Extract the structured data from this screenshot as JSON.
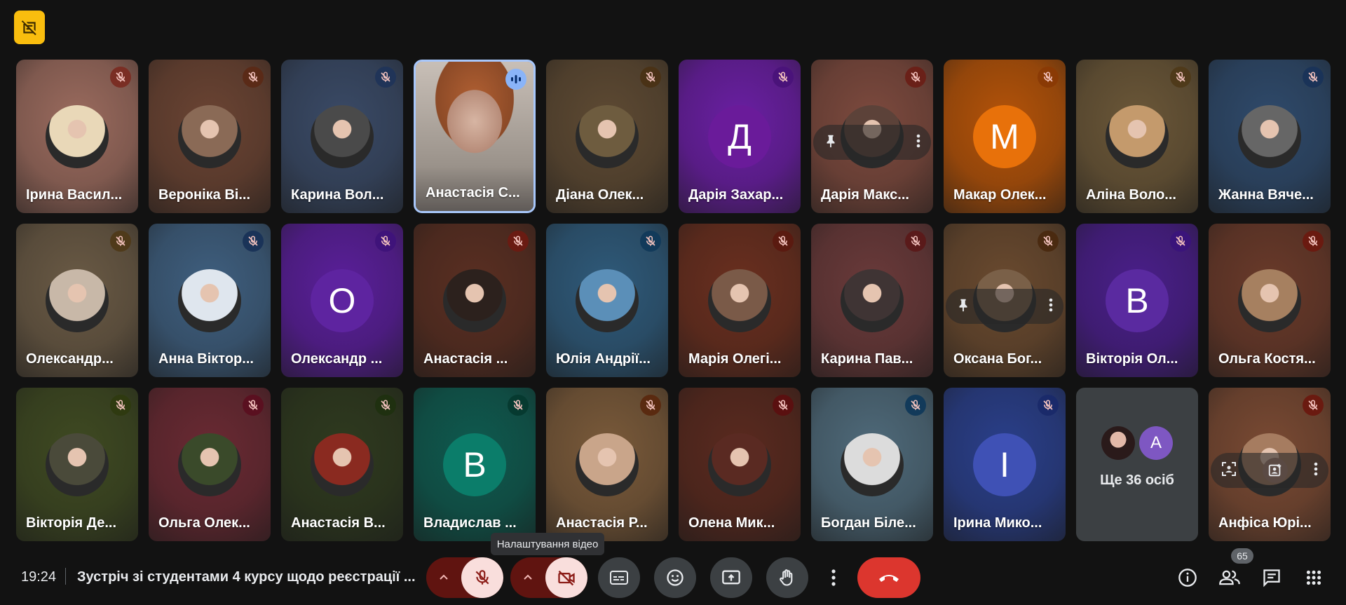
{
  "participants": [
    {
      "name": "Ірина Васил...",
      "bg": "#9b6b5e",
      "avatar": "photo",
      "avatar_color": "#e9d8b8",
      "mic_color": "#7a2e24"
    },
    {
      "name": "Вероніка Ві...",
      "bg": "#6b4433",
      "avatar": "photo",
      "avatar_color": "#8a6a56",
      "mic_color": "#5a2a17"
    },
    {
      "name": "Карина Вол...",
      "bg": "#3a4a66",
      "avatar": "photo",
      "avatar_color": "#4a4a4a",
      "mic_color": "#203458"
    },
    {
      "name": "Анастасія С...",
      "bg": "#b79a8c",
      "avatar": "video",
      "avatar_color": "#c9a090",
      "mic_color": "#8ab4f8",
      "speaking": true
    },
    {
      "name": "Діана Олек...",
      "bg": "#5e4a33",
      "avatar": "photo",
      "avatar_color": "#6e5c3f",
      "mic_color": "#4a3216"
    },
    {
      "name": "Дарія Захар...",
      "bg": "#6a1fa3",
      "avatar": "letter",
      "letter": "Д",
      "avatar_color": "#6a1b9a",
      "mic_color": "#4a137a"
    },
    {
      "name": "Дарія Макс...",
      "bg": "#7d4a3e",
      "avatar": "photo",
      "avatar_color": "#5c4239",
      "mic_color": "#6a2018",
      "hover": true
    },
    {
      "name": "Макар Олек...",
      "bg": "#b45309",
      "avatar": "letter",
      "letter": "М",
      "avatar_color": "#e8710a",
      "mic_color": "#8a3a05"
    },
    {
      "name": "Аліна Воло...",
      "bg": "#6b5738",
      "avatar": "photo",
      "avatar_color": "#c49a6c",
      "mic_color": "#4f3a1a"
    },
    {
      "name": "Жанна Вяче...",
      "bg": "#2f4a6b",
      "avatar": "photo",
      "avatar_color": "#666666",
      "mic_color": "#1a3358"
    },
    {
      "name": "Олександр...",
      "bg": "#6a5a45",
      "avatar": "photo",
      "avatar_color": "#c8b8a8",
      "mic_color": "#4f3a1a"
    },
    {
      "name": "Анна Віктор...",
      "bg": "#3f5f7f",
      "avatar": "photo",
      "avatar_color": "#dfe6ee",
      "mic_color": "#1a3358"
    },
    {
      "name": "Олександр ...",
      "bg": "#5a1f9a",
      "avatar": "letter",
      "letter": "О",
      "avatar_color": "#5e24a0",
      "mic_color": "#3f137a"
    },
    {
      "name": "Анастасія ...",
      "bg": "#5a2f22",
      "avatar": "photo",
      "avatar_color": "#2c211d",
      "mic_color": "#6a1b12"
    },
    {
      "name": "Юлія Андрії...",
      "bg": "#2f5a7a",
      "avatar": "photo",
      "avatar_color": "#5b8fb8",
      "mic_color": "#123a5a"
    },
    {
      "name": "Марія Олегі...",
      "bg": "#6a2f1f",
      "avatar": "photo",
      "avatar_color": "#7a5a48",
      "mic_color": "#5a1a10"
    },
    {
      "name": "Карина Пав...",
      "bg": "#6a3a3a",
      "avatar": "photo",
      "avatar_color": "#3f3434",
      "mic_color": "#5a1a1a"
    },
    {
      "name": "Оксана Бог...",
      "bg": "#6a4a2f",
      "avatar": "photo",
      "avatar_color": "#7a6048",
      "mic_color": "#4a2a10",
      "hover": true
    },
    {
      "name": "Вікторія Ол...",
      "bg": "#4a1f8a",
      "avatar": "letter",
      "letter": "В",
      "avatar_color": "#5a2aa0",
      "mic_color": "#3a147a"
    },
    {
      "name": "Ольга Костя...",
      "bg": "#6a3a2a",
      "avatar": "photo",
      "avatar_color": "#a68060",
      "mic_color": "#6a1a10"
    },
    {
      "name": "Вікторія Де...",
      "bg": "#3f4a22",
      "avatar": "photo",
      "avatar_color": "#4a4a3a",
      "mic_color": "#2f3a10"
    },
    {
      "name": "Ольга Олек...",
      "bg": "#6a2a33",
      "avatar": "photo",
      "avatar_color": "#3a4a2a",
      "mic_color": "#5a1020"
    },
    {
      "name": "Анастасія В...",
      "bg": "#2f3a1f",
      "avatar": "photo",
      "avatar_color": "#8a2a20",
      "mic_color": "#1f3010"
    },
    {
      "name": "Владислав ...",
      "bg": "#0f5a4f",
      "avatar": "letter",
      "letter": "В",
      "avatar_color": "#0b7d6a",
      "mic_color": "#063a30"
    },
    {
      "name": "Анастасія Р...",
      "bg": "#7a5a3a",
      "avatar": "photo",
      "avatar_color": "#c9a58a",
      "mic_color": "#5a2a10"
    },
    {
      "name": "Олена Мик...",
      "bg": "#5a2a1f",
      "avatar": "photo",
      "avatar_color": "#5a2a22",
      "mic_color": "#5a1010"
    },
    {
      "name": "Богдан Біле...",
      "bg": "#4f6a7a",
      "avatar": "photo",
      "avatar_color": "#dcdcdc",
      "mic_color": "#123a5a"
    },
    {
      "name": "Ірина Мико...",
      "bg": "#2a3f8a",
      "avatar": "letter",
      "letter": "І",
      "avatar_color": "#3f51b5",
      "mic_color": "#1a2a6a"
    },
    {
      "more": true,
      "label": "Ще 36 осіб",
      "small_letter": "А"
    },
    {
      "name": "Анфіса Юрі...",
      "bg": "#7a4a33",
      "avatar": "photo",
      "avatar_color": "#a67c60",
      "mic_color": "#6a1a10",
      "hover2": true
    }
  ],
  "bottom_bar": {
    "time": "19:24",
    "meeting_title": "Зустріч зі студентами 4 курсу щодо реєстрації ...",
    "tooltip": "Налаштування відео",
    "participant_count": "65"
  }
}
